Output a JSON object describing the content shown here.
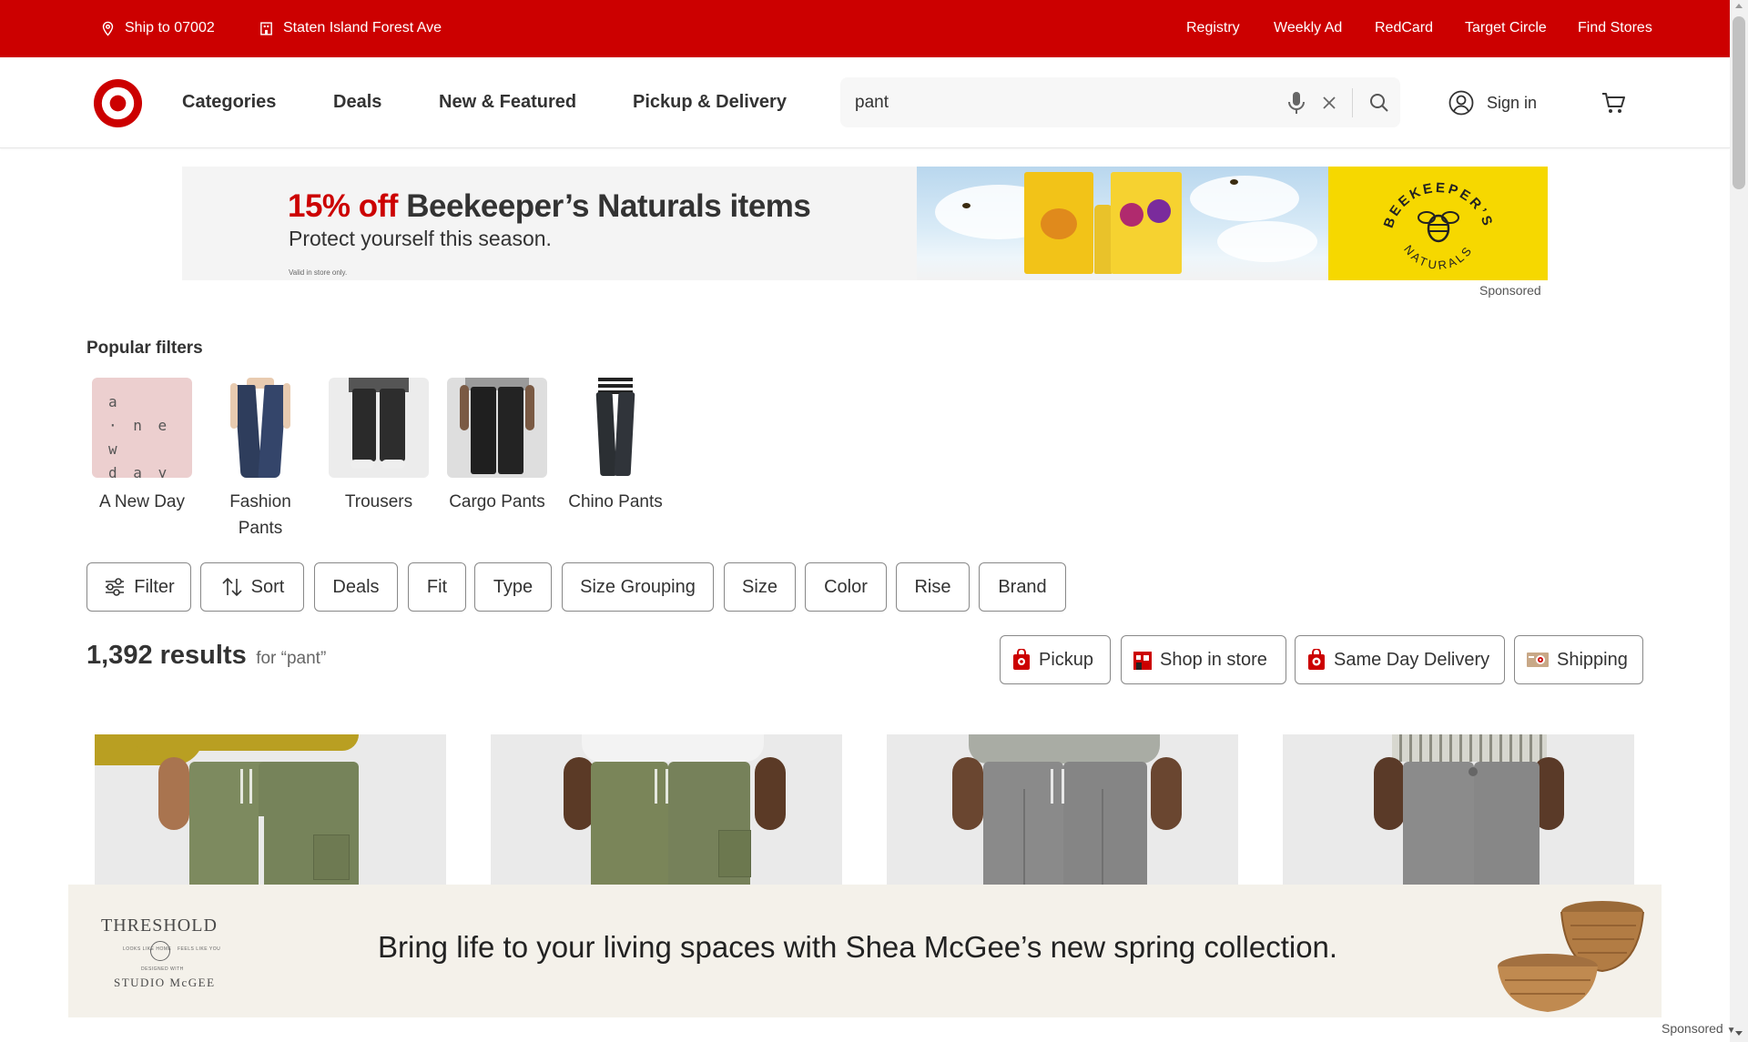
{
  "utility_bar": {
    "ship_to": "Ship to 07002",
    "store": "Staten Island Forest Ave",
    "links": [
      "Registry",
      "Weekly Ad",
      "RedCard",
      "Target Circle",
      "Find Stores"
    ]
  },
  "header": {
    "nav": [
      "Categories",
      "Deals",
      "New & Featured",
      "Pickup & Delivery"
    ],
    "search_value": "pant",
    "sign_in": "Sign in"
  },
  "promo_banner": {
    "discount": "15% off",
    "headline_rest": "Beekeeper’s Naturals items",
    "subhead": "Protect yourself this season.",
    "fine_print": "Valid in store only.",
    "brand_line1": "BEEKEEPER’S",
    "brand_line2": "NATURALS",
    "sponsored": "Sponsored"
  },
  "popular_filters": {
    "title": "Popular filters",
    "anewday_logo": [
      "a",
      "· n e w",
      "d a y"
    ],
    "items": [
      {
        "label": "A New Day"
      },
      {
        "label": "Fashion Pants"
      },
      {
        "label": "Trousers"
      },
      {
        "label": "Cargo Pants"
      },
      {
        "label": "Chino Pants"
      }
    ]
  },
  "filter_chips": [
    "Filter",
    "Sort",
    "Deals",
    "Fit",
    "Type",
    "Size Grouping",
    "Size",
    "Color",
    "Rise",
    "Brand"
  ],
  "results": {
    "count": "1,392 results",
    "query": "for “pant”"
  },
  "fulfillment": [
    "Pickup",
    "Shop in store",
    "Same Day Delivery",
    "Shipping"
  ],
  "bottom_ad": {
    "brand": "THRESHOLD",
    "tag_left": "LOOKS LIKE HOME",
    "tag_right": "FEELS LIKE YOU",
    "designed_with": "DESIGNED WITH",
    "studio": "STUDIO McGEE",
    "headline": "Bring life to your living spaces with Shea McGee’s new spring collection.",
    "sponsored": "Sponsored"
  },
  "colors": {
    "brand_red": "#cc0000",
    "olive": "#7d8a5f",
    "gray_pant": "#8a8a8a"
  }
}
